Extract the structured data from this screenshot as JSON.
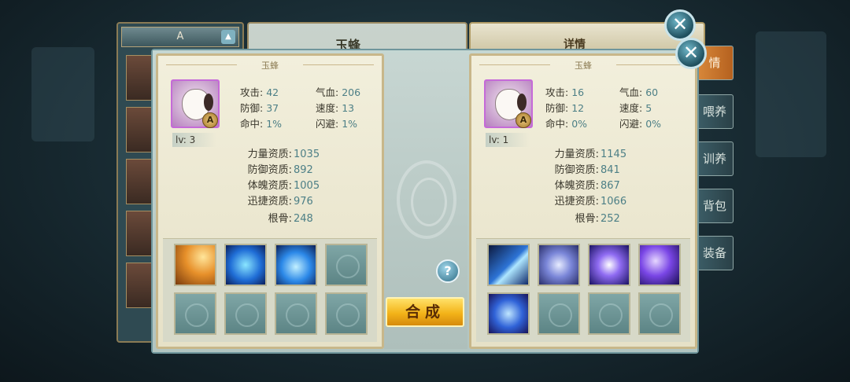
{
  "background_window": {
    "list_tab_label": "A",
    "center_title": "玉蜂",
    "right_title": "详情",
    "side_tabs": [
      "情",
      "喂养",
      "训养",
      "背包",
      "装备"
    ]
  },
  "left_card": {
    "title": "玉蜂",
    "rank": "A",
    "level": "lv: 3",
    "stats": [
      {
        "label": "攻击:",
        "value": "42"
      },
      {
        "label": "气血:",
        "value": "206"
      },
      {
        "label": "防御:",
        "value": "37"
      },
      {
        "label": "速度:",
        "value": "13"
      },
      {
        "label": "命中:",
        "value": "1%"
      },
      {
        "label": "闪避:",
        "value": "1%"
      }
    ],
    "aptitudes": [
      {
        "label": "力量资质:",
        "value": "1035"
      },
      {
        "label": "防御资质:",
        "value": "892"
      },
      {
        "label": "体魄资质:",
        "value": "1005"
      },
      {
        "label": "迅捷资质:",
        "value": "976"
      },
      {
        "label": "根骨:",
        "value": "248"
      }
    ],
    "skills": [
      "claw-strike-skill-icon",
      "blue-beast-skill-icon",
      "water-heart-skill-icon",
      "empty",
      "empty",
      "empty",
      "empty",
      "empty"
    ]
  },
  "right_card": {
    "title": "玉蜂",
    "rank": "A",
    "level": "lv: 1",
    "stats": [
      {
        "label": "攻击:",
        "value": "16"
      },
      {
        "label": "气血:",
        "value": "60"
      },
      {
        "label": "防御:",
        "value": "12"
      },
      {
        "label": "速度:",
        "value": "5"
      },
      {
        "label": "命中:",
        "value": "0%"
      },
      {
        "label": "闪避:",
        "value": "0%"
      }
    ],
    "aptitudes": [
      {
        "label": "力量资质:",
        "value": "1145"
      },
      {
        "label": "防御资质:",
        "value": "841"
      },
      {
        "label": "体魄资质:",
        "value": "867"
      },
      {
        "label": "迅捷资质:",
        "value": "1066"
      },
      {
        "label": "根骨:",
        "value": "252"
      }
    ],
    "skills": [
      "slash-skill-icon",
      "orb-skill-icon",
      "vortex-skill-icon",
      "lightning-skill-icon",
      "shield-skill-icon",
      "empty",
      "empty",
      "empty"
    ]
  },
  "buttons": {
    "combine_label": "合成",
    "help_label": "?",
    "close_label": "✕"
  },
  "colors": {
    "stat_value": "#4c7f86",
    "combine_button": "#f3b319",
    "portrait_border": "#c56ad8"
  }
}
